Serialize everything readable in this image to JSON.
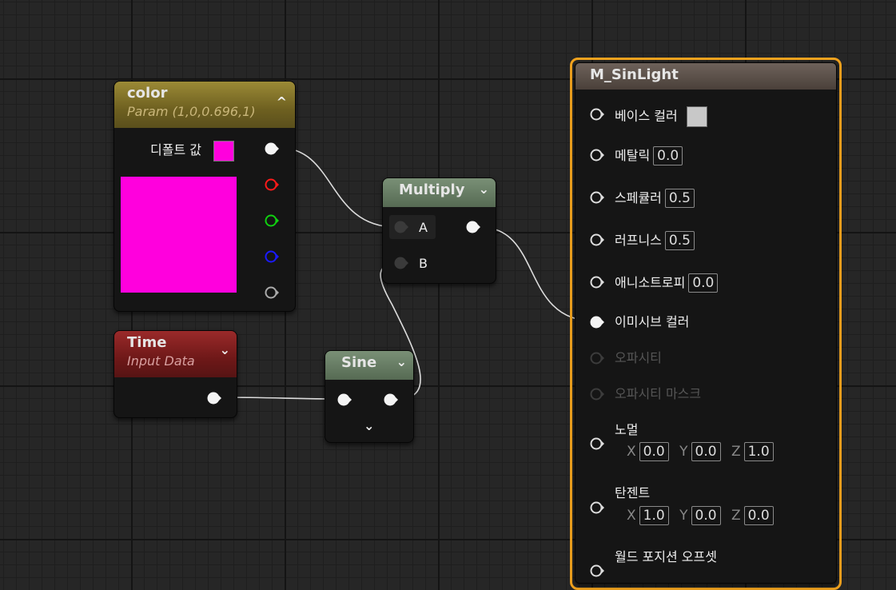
{
  "color_node": {
    "title": "color",
    "subtitle": "Param (1,0,0.696,1)",
    "default_label": "디폴트 값",
    "swatch_color": "#ff00dd"
  },
  "time_node": {
    "title": "Time",
    "subtitle": "Input Data"
  },
  "multiply_node": {
    "title": "Multiply",
    "pin_a": "A",
    "pin_b": "B"
  },
  "sine_node": {
    "title": "Sine"
  },
  "material_node": {
    "title": "M_SinLight",
    "base_color": {
      "label": "베이스 컬러",
      "swatch": "#c8c8c8"
    },
    "metallic": {
      "label": "메탈릭",
      "value": "0.0"
    },
    "specular": {
      "label": "스페큘러",
      "value": "0.5"
    },
    "roughness": {
      "label": "러프니스",
      "value": "0.5"
    },
    "anisotropy": {
      "label": "애니소트로피",
      "value": "0.0"
    },
    "emissive": {
      "label": "이미시브 컬러"
    },
    "opacity": {
      "label": "오파시티"
    },
    "opacity_mask": {
      "label": "오파시티 마스크"
    },
    "normal": {
      "label": "노멀",
      "x": "0.0",
      "y": "0.0",
      "z": "1.0"
    },
    "tangent": {
      "label": "탄젠트",
      "x": "1.0",
      "y": "0.0",
      "z": "0.0"
    },
    "world_offset": {
      "label": "월드 포지션 오프셋"
    }
  },
  "axis_labels": {
    "x": "X",
    "y": "Y",
    "z": "Z"
  },
  "colors": {
    "accent_selected": "#f0a21e",
    "param_header": "#7a6a22",
    "input_header": "#7a1818",
    "math_header": "#5a7058",
    "pin_red": "#ff1a1a",
    "pin_green": "#10d010",
    "pin_blue": "#1a1aff"
  }
}
